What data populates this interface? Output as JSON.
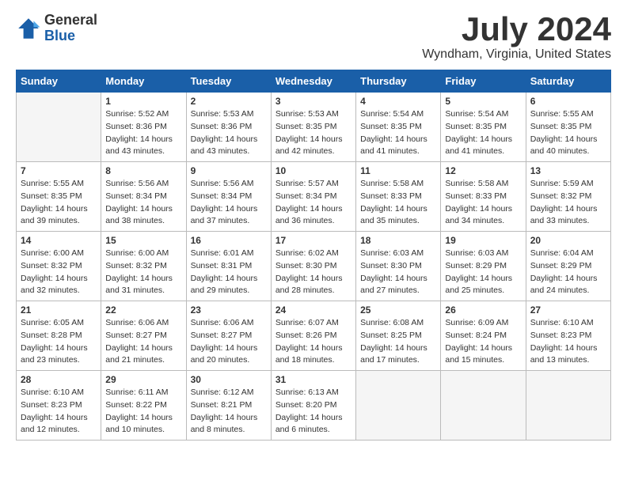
{
  "logo": {
    "general": "General",
    "blue": "Blue"
  },
  "title": "July 2024",
  "subtitle": "Wyndham, Virginia, United States",
  "weekdays": [
    "Sunday",
    "Monday",
    "Tuesday",
    "Wednesday",
    "Thursday",
    "Friday",
    "Saturday"
  ],
  "weeks": [
    [
      {
        "day": "",
        "empty": true
      },
      {
        "day": "1",
        "sunrise": "5:52 AM",
        "sunset": "8:36 PM",
        "daylight": "14 hours and 43 minutes."
      },
      {
        "day": "2",
        "sunrise": "5:53 AM",
        "sunset": "8:36 PM",
        "daylight": "14 hours and 43 minutes."
      },
      {
        "day": "3",
        "sunrise": "5:53 AM",
        "sunset": "8:35 PM",
        "daylight": "14 hours and 42 minutes."
      },
      {
        "day": "4",
        "sunrise": "5:54 AM",
        "sunset": "8:35 PM",
        "daylight": "14 hours and 41 minutes."
      },
      {
        "day": "5",
        "sunrise": "5:54 AM",
        "sunset": "8:35 PM",
        "daylight": "14 hours and 41 minutes."
      },
      {
        "day": "6",
        "sunrise": "5:55 AM",
        "sunset": "8:35 PM",
        "daylight": "14 hours and 40 minutes."
      }
    ],
    [
      {
        "day": "7",
        "sunrise": "5:55 AM",
        "sunset": "8:35 PM",
        "daylight": "14 hours and 39 minutes."
      },
      {
        "day": "8",
        "sunrise": "5:56 AM",
        "sunset": "8:34 PM",
        "daylight": "14 hours and 38 minutes."
      },
      {
        "day": "9",
        "sunrise": "5:56 AM",
        "sunset": "8:34 PM",
        "daylight": "14 hours and 37 minutes."
      },
      {
        "day": "10",
        "sunrise": "5:57 AM",
        "sunset": "8:34 PM",
        "daylight": "14 hours and 36 minutes."
      },
      {
        "day": "11",
        "sunrise": "5:58 AM",
        "sunset": "8:33 PM",
        "daylight": "14 hours and 35 minutes."
      },
      {
        "day": "12",
        "sunrise": "5:58 AM",
        "sunset": "8:33 PM",
        "daylight": "14 hours and 34 minutes."
      },
      {
        "day": "13",
        "sunrise": "5:59 AM",
        "sunset": "8:32 PM",
        "daylight": "14 hours and 33 minutes."
      }
    ],
    [
      {
        "day": "14",
        "sunrise": "6:00 AM",
        "sunset": "8:32 PM",
        "daylight": "14 hours and 32 minutes."
      },
      {
        "day": "15",
        "sunrise": "6:00 AM",
        "sunset": "8:32 PM",
        "daylight": "14 hours and 31 minutes."
      },
      {
        "day": "16",
        "sunrise": "6:01 AM",
        "sunset": "8:31 PM",
        "daylight": "14 hours and 29 minutes."
      },
      {
        "day": "17",
        "sunrise": "6:02 AM",
        "sunset": "8:30 PM",
        "daylight": "14 hours and 28 minutes."
      },
      {
        "day": "18",
        "sunrise": "6:03 AM",
        "sunset": "8:30 PM",
        "daylight": "14 hours and 27 minutes."
      },
      {
        "day": "19",
        "sunrise": "6:03 AM",
        "sunset": "8:29 PM",
        "daylight": "14 hours and 25 minutes."
      },
      {
        "day": "20",
        "sunrise": "6:04 AM",
        "sunset": "8:29 PM",
        "daylight": "14 hours and 24 minutes."
      }
    ],
    [
      {
        "day": "21",
        "sunrise": "6:05 AM",
        "sunset": "8:28 PM",
        "daylight": "14 hours and 23 minutes."
      },
      {
        "day": "22",
        "sunrise": "6:06 AM",
        "sunset": "8:27 PM",
        "daylight": "14 hours and 21 minutes."
      },
      {
        "day": "23",
        "sunrise": "6:06 AM",
        "sunset": "8:27 PM",
        "daylight": "14 hours and 20 minutes."
      },
      {
        "day": "24",
        "sunrise": "6:07 AM",
        "sunset": "8:26 PM",
        "daylight": "14 hours and 18 minutes."
      },
      {
        "day": "25",
        "sunrise": "6:08 AM",
        "sunset": "8:25 PM",
        "daylight": "14 hours and 17 minutes."
      },
      {
        "day": "26",
        "sunrise": "6:09 AM",
        "sunset": "8:24 PM",
        "daylight": "14 hours and 15 minutes."
      },
      {
        "day": "27",
        "sunrise": "6:10 AM",
        "sunset": "8:23 PM",
        "daylight": "14 hours and 13 minutes."
      }
    ],
    [
      {
        "day": "28",
        "sunrise": "6:10 AM",
        "sunset": "8:23 PM",
        "daylight": "14 hours and 12 minutes."
      },
      {
        "day": "29",
        "sunrise": "6:11 AM",
        "sunset": "8:22 PM",
        "daylight": "14 hours and 10 minutes."
      },
      {
        "day": "30",
        "sunrise": "6:12 AM",
        "sunset": "8:21 PM",
        "daylight": "14 hours and 8 minutes."
      },
      {
        "day": "31",
        "sunrise": "6:13 AM",
        "sunset": "8:20 PM",
        "daylight": "14 hours and 6 minutes."
      },
      {
        "day": "",
        "empty": true
      },
      {
        "day": "",
        "empty": true
      },
      {
        "day": "",
        "empty": true
      }
    ]
  ]
}
